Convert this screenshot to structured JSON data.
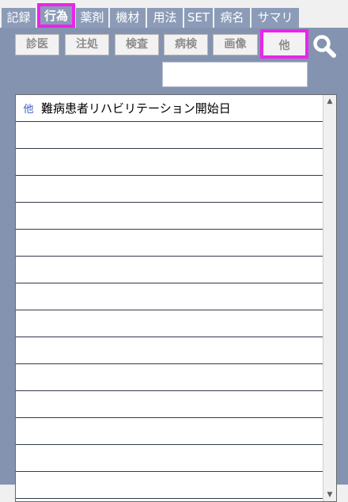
{
  "tabs": [
    {
      "label": "記録",
      "active": false
    },
    {
      "label": "行為",
      "active": true
    },
    {
      "label": "薬剤",
      "active": false
    },
    {
      "label": "機材",
      "active": false
    },
    {
      "label": "用法",
      "active": false
    },
    {
      "label": "SET",
      "active": false
    },
    {
      "label": "病名",
      "active": false
    },
    {
      "label": "サマリ",
      "active": false
    }
  ],
  "filter_buttons": [
    {
      "label": "診医",
      "selected": false
    },
    {
      "label": "注処",
      "selected": false
    },
    {
      "label": "検査",
      "selected": false
    },
    {
      "label": "病検",
      "selected": false
    },
    {
      "label": "画像",
      "selected": false
    },
    {
      "label": "他",
      "selected": true
    }
  ],
  "search": {
    "value": "",
    "icon": "search-icon"
  },
  "list": {
    "items": [
      {
        "category": "他",
        "name": "難病患者リハビリテーション開始日"
      },
      {
        "category": "",
        "name": ""
      },
      {
        "category": "",
        "name": ""
      },
      {
        "category": "",
        "name": ""
      },
      {
        "category": "",
        "name": ""
      },
      {
        "category": "",
        "name": ""
      },
      {
        "category": "",
        "name": ""
      },
      {
        "category": "",
        "name": ""
      },
      {
        "category": "",
        "name": ""
      },
      {
        "category": "",
        "name": ""
      },
      {
        "category": "",
        "name": ""
      },
      {
        "category": "",
        "name": ""
      },
      {
        "category": "",
        "name": ""
      },
      {
        "category": "",
        "name": ""
      },
      {
        "category": "",
        "name": ""
      }
    ]
  },
  "scrollbar": {
    "up": "▲",
    "down": "▼"
  },
  "colors": {
    "panel": "#8493b0",
    "tab": "#8c9cb8",
    "highlight": "#ea25ea",
    "category_text": "#3a5ac8"
  }
}
